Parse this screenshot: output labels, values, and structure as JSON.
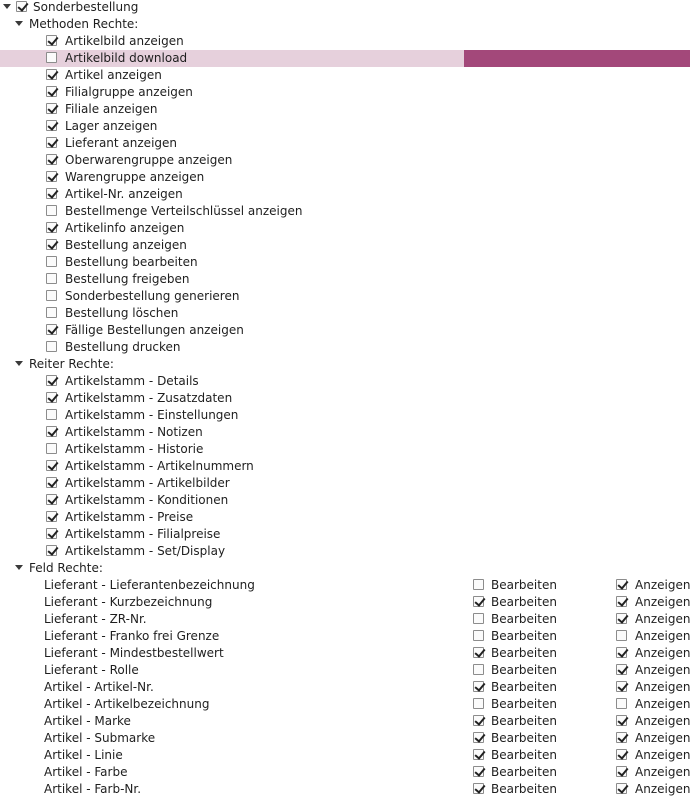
{
  "root": {
    "label": "Sonderbestellung",
    "checked": true
  },
  "sections": [
    {
      "label": "Methoden Rechte:",
      "type": "checks",
      "items": [
        {
          "label": "Artikelbild anzeigen",
          "checked": true
        },
        {
          "label": "Artikelbild download",
          "checked": false,
          "selected": true
        },
        {
          "label": "Artikel anzeigen",
          "checked": true
        },
        {
          "label": "Filialgruppe anzeigen",
          "checked": true
        },
        {
          "label": "Filiale anzeigen",
          "checked": true
        },
        {
          "label": "Lager anzeigen",
          "checked": true
        },
        {
          "label": "Lieferant anzeigen",
          "checked": true
        },
        {
          "label": "Oberwarengruppe anzeigen",
          "checked": true
        },
        {
          "label": "Warengruppe anzeigen",
          "checked": true
        },
        {
          "label": "Artikel-Nr. anzeigen",
          "checked": true
        },
        {
          "label": "Bestellmenge Verteilschlüssel anzeigen",
          "checked": false
        },
        {
          "label": "Artikelinfo anzeigen",
          "checked": true
        },
        {
          "label": "Bestellung anzeigen",
          "checked": true
        },
        {
          "label": "Bestellung bearbeiten",
          "checked": false
        },
        {
          "label": "Bestellung freigeben",
          "checked": false
        },
        {
          "label": "Sonderbestellung generieren",
          "checked": false
        },
        {
          "label": "Bestellung löschen",
          "checked": false
        },
        {
          "label": "Fällige Bestellungen anzeigen",
          "checked": true
        },
        {
          "label": "Bestellung drucken",
          "checked": false
        }
      ]
    },
    {
      "label": "Reiter Rechte:",
      "type": "checks",
      "items": [
        {
          "label": "Artikelstamm - Details",
          "checked": true
        },
        {
          "label": "Artikelstamm - Zusatzdaten",
          "checked": true
        },
        {
          "label": "Artikelstamm - Einstellungen",
          "checked": false
        },
        {
          "label": "Artikelstamm - Notizen",
          "checked": true
        },
        {
          "label": "Artikelstamm - Historie",
          "checked": false
        },
        {
          "label": "Artikelstamm - Artikelnummern",
          "checked": true
        },
        {
          "label": "Artikelstamm - Artikelbilder",
          "checked": true
        },
        {
          "label": "Artikelstamm - Konditionen",
          "checked": true
        },
        {
          "label": "Artikelstamm - Preise",
          "checked": true
        },
        {
          "label": "Artikelstamm - Filialpreise",
          "checked": true
        },
        {
          "label": "Artikelstamm - Set/Display",
          "checked": true
        }
      ]
    },
    {
      "label": "Feld Rechte:",
      "type": "fields",
      "items": [
        {
          "label": "Lieferant - Lieferantenbezeichnung",
          "edit": false,
          "show": true
        },
        {
          "label": "Lieferant - Kurzbezeichnung",
          "edit": true,
          "show": true
        },
        {
          "label": "Lieferant - ZR-Nr.",
          "edit": false,
          "show": true
        },
        {
          "label": "Lieferant - Franko frei Grenze",
          "edit": false,
          "show": false
        },
        {
          "label": "Lieferant - Mindestbestellwert",
          "edit": true,
          "show": true
        },
        {
          "label": "Lieferant - Rolle",
          "edit": false,
          "show": true
        },
        {
          "label": "Artikel - Artikel-Nr.",
          "edit": true,
          "show": true
        },
        {
          "label": "Artikel - Artikelbezeichnung",
          "edit": false,
          "show": false
        },
        {
          "label": "Artikel - Marke",
          "edit": true,
          "show": true
        },
        {
          "label": "Artikel - Submarke",
          "edit": true,
          "show": true
        },
        {
          "label": "Artikel - Linie",
          "edit": true,
          "show": true
        },
        {
          "label": "Artikel - Farbe",
          "edit": true,
          "show": true
        },
        {
          "label": "Artikel - Farb-Nr.",
          "edit": true,
          "show": true
        }
      ]
    }
  ],
  "field_labels": {
    "edit": "Bearbeiten",
    "show": "Anzeigen"
  }
}
